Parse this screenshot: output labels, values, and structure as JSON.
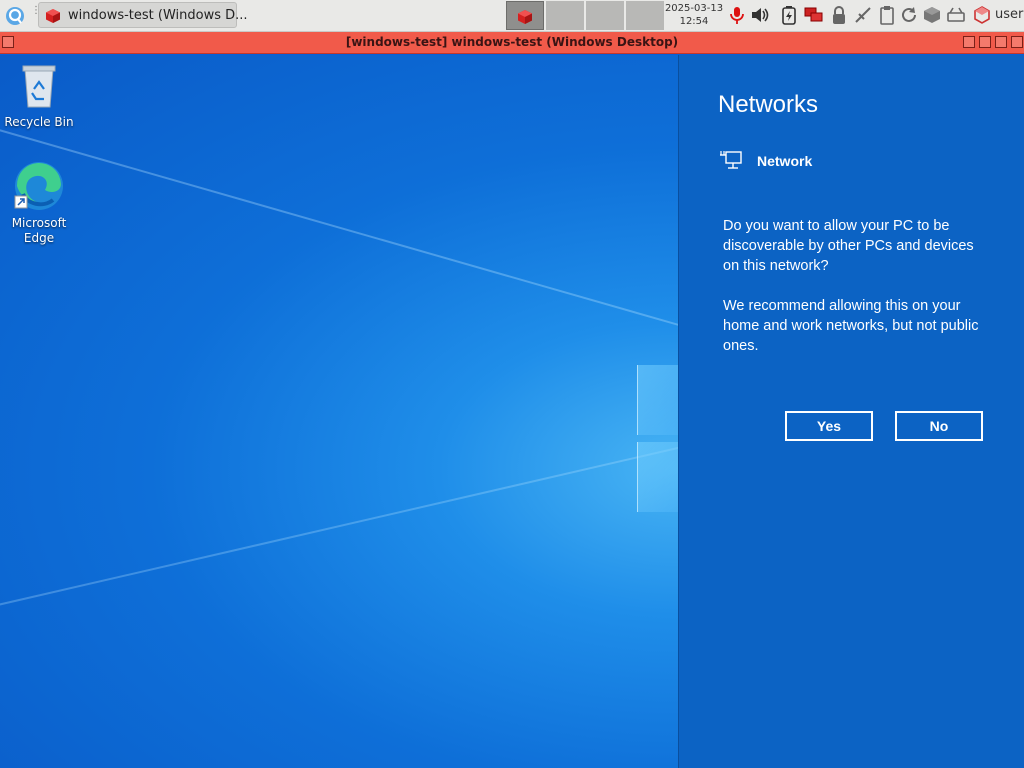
{
  "taskbar": {
    "task_button_label": "windows-test (Windows D...",
    "clock_date": "2025-03-13",
    "clock_time": "12:54",
    "user_label": "user"
  },
  "window": {
    "title": "[windows-test] windows-test (Windows Desktop)"
  },
  "desktop": {
    "icons": [
      {
        "label": "Recycle Bin"
      },
      {
        "label": "Microsoft Edge"
      }
    ]
  },
  "flyout": {
    "heading": "Networks",
    "network_name": "Network",
    "question": "Do you want to allow your PC to be discoverable by other PCs and devices on this network?",
    "recommendation": "We recommend allowing this on your home and work networks, but not public ones.",
    "yes_label": "Yes",
    "no_label": "No"
  },
  "colors": {
    "titlebar": "#f15a4a",
    "flyout_bg": "#0c63c4",
    "desktop_bg": "#0e6fd8"
  }
}
